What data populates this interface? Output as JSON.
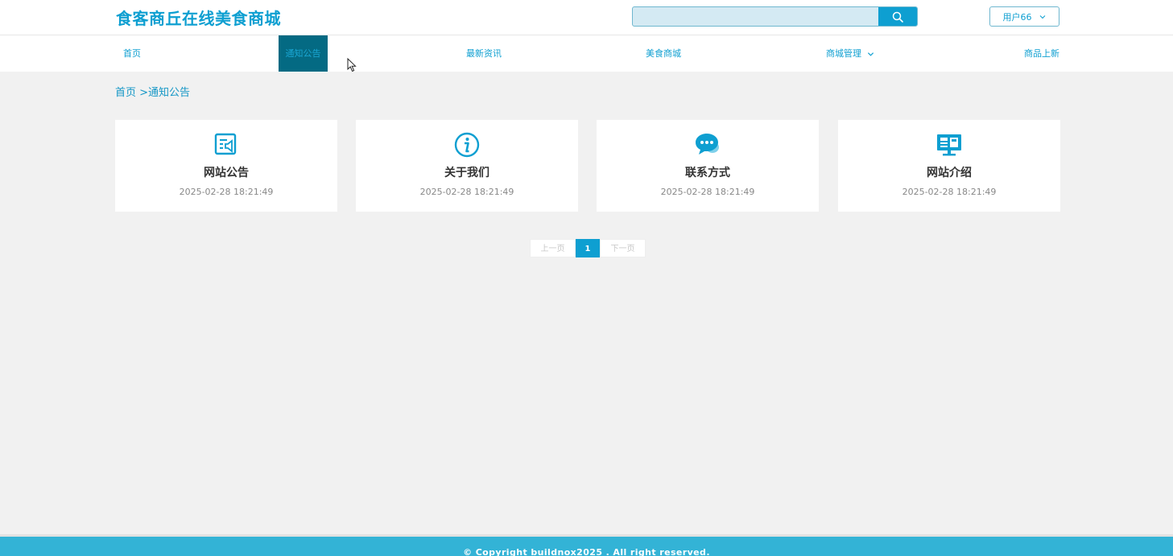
{
  "header": {
    "title": "食客商丘在线美食商城",
    "search": {
      "value": "",
      "placeholder": ""
    },
    "user_label": "用户66"
  },
  "nav": {
    "items": [
      {
        "label": "首页",
        "active": false
      },
      {
        "label": "通知公告",
        "active": true
      },
      {
        "label": "最新资讯",
        "active": false
      },
      {
        "label": "美食商城",
        "active": false
      },
      {
        "label": "商城管理",
        "active": false,
        "dropdown": true
      },
      {
        "label": "商品上新",
        "active": false
      }
    ]
  },
  "breadcrumb": {
    "home": "首页",
    "separator": " >",
    "current": "通知公告"
  },
  "cards": [
    {
      "title": "网站公告",
      "date": "2025-02-28 18:21:49",
      "icon": "announcement-icon"
    },
    {
      "title": "关于我们",
      "date": "2025-02-28 18:21:49",
      "icon": "info-icon"
    },
    {
      "title": "联系方式",
      "date": "2025-02-28 18:21:49",
      "icon": "chat-icon"
    },
    {
      "title": "网站介绍",
      "date": "2025-02-28 18:21:49",
      "icon": "monitor-icon"
    }
  ],
  "pagination": {
    "prev": "上一页",
    "current": "1",
    "next": "下一页"
  },
  "footer": {
    "copyright": "© Copyright buildnox2025 . All right reserved."
  },
  "colors": {
    "accent": "#0e9fd1",
    "nav_active_bg": "#046a83",
    "footer_bg": "#33b3d6",
    "page_bg": "#f1f1f1"
  }
}
